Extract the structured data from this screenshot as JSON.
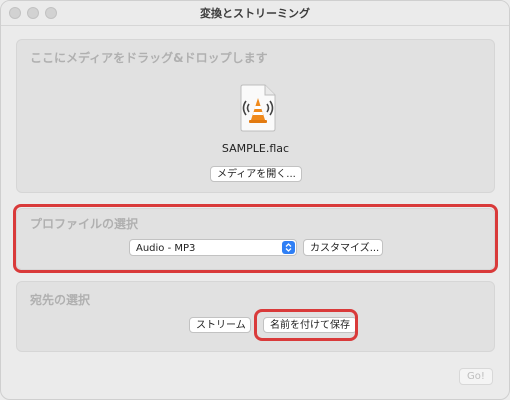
{
  "window": {
    "title": "変換とストリーミング"
  },
  "media": {
    "heading": "ここにメディアをドラッグ&ドロップします",
    "file_name": "SAMPLE.flac",
    "file_icon": "vlc-flac-file-icon",
    "open_button": "メディアを開く..."
  },
  "profile": {
    "heading": "プロファイルの選択",
    "selected": "Audio - MP3",
    "customize_button": "カスタマイズ..."
  },
  "destination": {
    "heading": "宛先の選択",
    "stream_button": "ストリーム",
    "save_button": "名前を付けて保存"
  },
  "footer": {
    "go_button": "Go!"
  },
  "colors": {
    "highlight": "#d93a3a",
    "select_accent": "#2f7ff5",
    "vlc_orange": "#f08a1c"
  }
}
